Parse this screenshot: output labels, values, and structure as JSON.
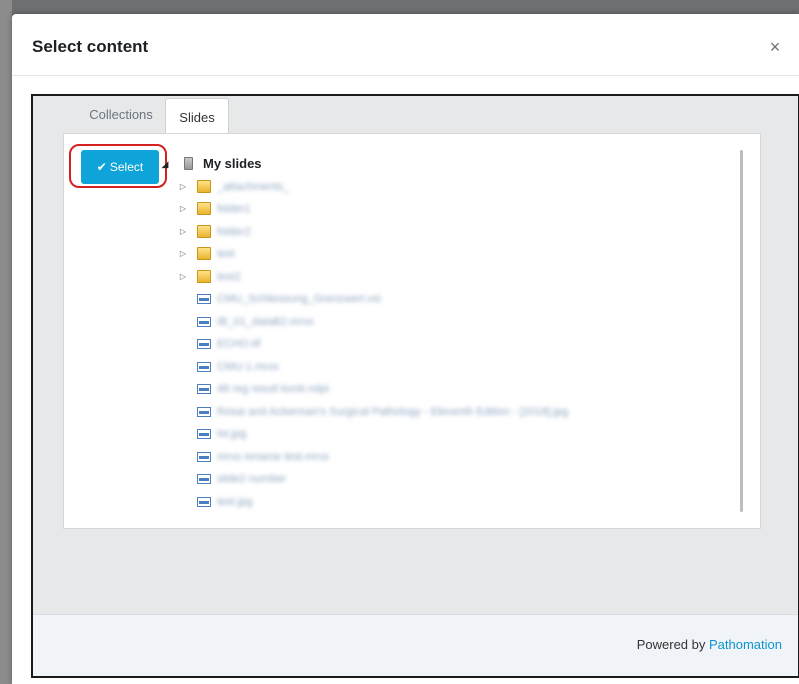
{
  "modal": {
    "title": "Select content",
    "close_label": "×"
  },
  "tabs": [
    {
      "label": "Collections",
      "active": false
    },
    {
      "label": "Slides",
      "active": true
    }
  ],
  "select_button": {
    "icon": "checkmark-icon",
    "label": "Select"
  },
  "tree": {
    "root": {
      "label": "My slides",
      "expanded": true,
      "icon": "drive-icon"
    },
    "folders": [
      {
        "label": "_attachments_"
      },
      {
        "label": "folder1"
      },
      {
        "label": "folder2"
      },
      {
        "label": "test"
      },
      {
        "label": "test2"
      }
    ],
    "slides": [
      {
        "label": "CMU_Schliessung_Grenzwert.vsi"
      },
      {
        "label": "IB_01_dataB2.mrxs"
      },
      {
        "label": "ECHO.tif"
      },
      {
        "label": "CMU-1.mrxs"
      },
      {
        "label": "48 reg result kontr.ndpi"
      },
      {
        "label": "Rosai and Ackerman's Surgical Pathology - Eleventh Edition - [2018].jpg"
      },
      {
        "label": "tst.jpg"
      },
      {
        "label": "mrxs rename test.mrxs"
      },
      {
        "label": "slide2 number"
      },
      {
        "label": "test.jpg"
      }
    ]
  },
  "footer": {
    "prefix": "Powered by",
    "link": "Pathomation"
  },
  "colors": {
    "accent": "#0ea4d9",
    "highlight": "#d42020",
    "link": "#0e95cf"
  }
}
